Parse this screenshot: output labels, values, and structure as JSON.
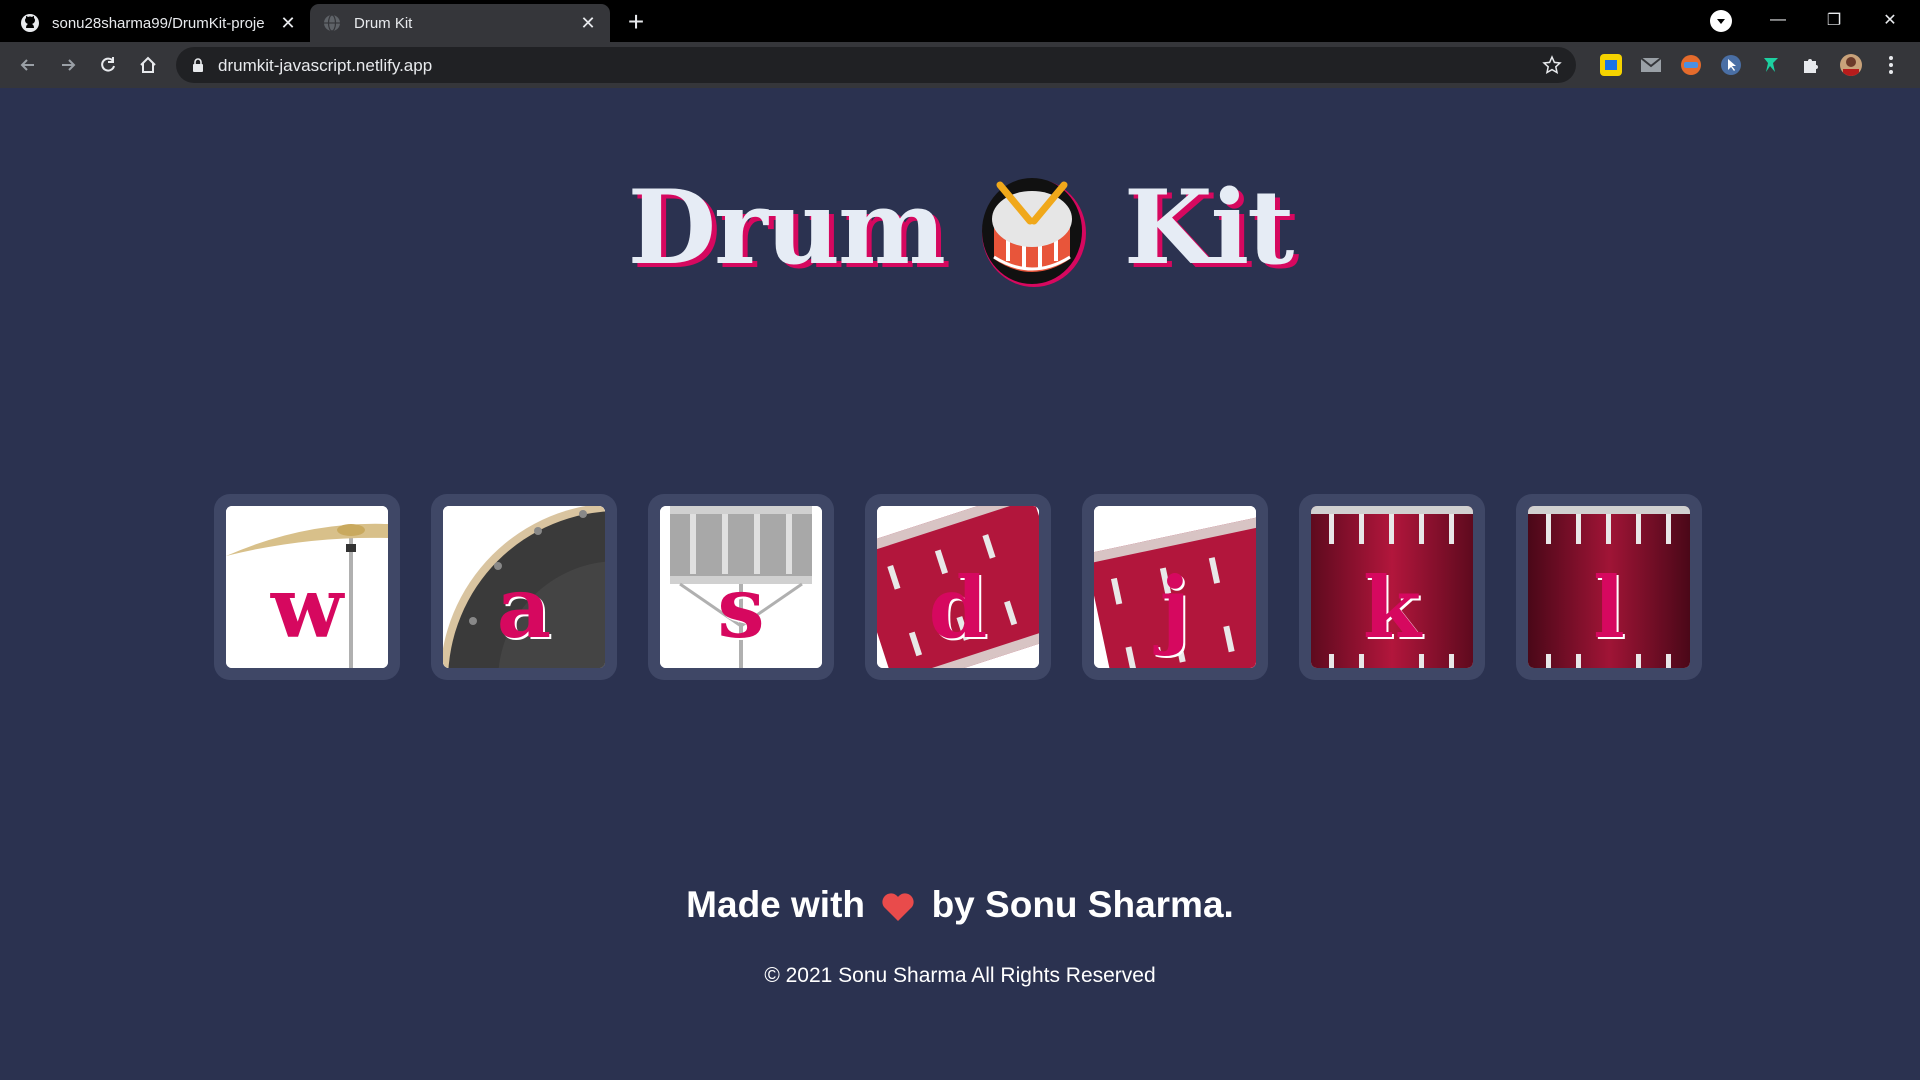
{
  "browser": {
    "tabs": [
      {
        "title": "sonu28sharma99/DrumKit-proje",
        "icon": "github-icon",
        "active": false
      },
      {
        "title": "Drum Kit",
        "icon": "globe-icon",
        "active": true
      }
    ],
    "new_tab_symbol": "+",
    "url": "drumkit-javascript.netlify.app",
    "window_controls": {
      "minimize": "—",
      "restore": "❐",
      "close": "✕"
    },
    "extensions": [
      "norton-icon",
      "mail-icon",
      "translator-icon",
      "cursor-icon",
      "bird-icon",
      "puzzle-icon",
      "profile-avatar",
      "menu-icon"
    ]
  },
  "page": {
    "title_left": "Drum",
    "title_right": "Kit",
    "title_emoji": "drum-emoji",
    "colors": {
      "background": "#2b3250",
      "key_frame": "#3f4766",
      "accent": "#d6085f",
      "title_text": "#e6ecf5"
    },
    "keys": [
      {
        "letter": "w",
        "instrument": "crash-cymbal"
      },
      {
        "letter": "a",
        "instrument": "kick-drum"
      },
      {
        "letter": "s",
        "instrument": "snare-drum"
      },
      {
        "letter": "d",
        "instrument": "tom-1"
      },
      {
        "letter": "j",
        "instrument": "tom-2"
      },
      {
        "letter": "k",
        "instrument": "tom-3"
      },
      {
        "letter": "l",
        "instrument": "tom-4"
      }
    ],
    "footer": {
      "made_with": "Made with",
      "by": "by Sonu Sharma.",
      "copyright": "© 2021 Sonu Sharma All Rights Reserved"
    }
  }
}
